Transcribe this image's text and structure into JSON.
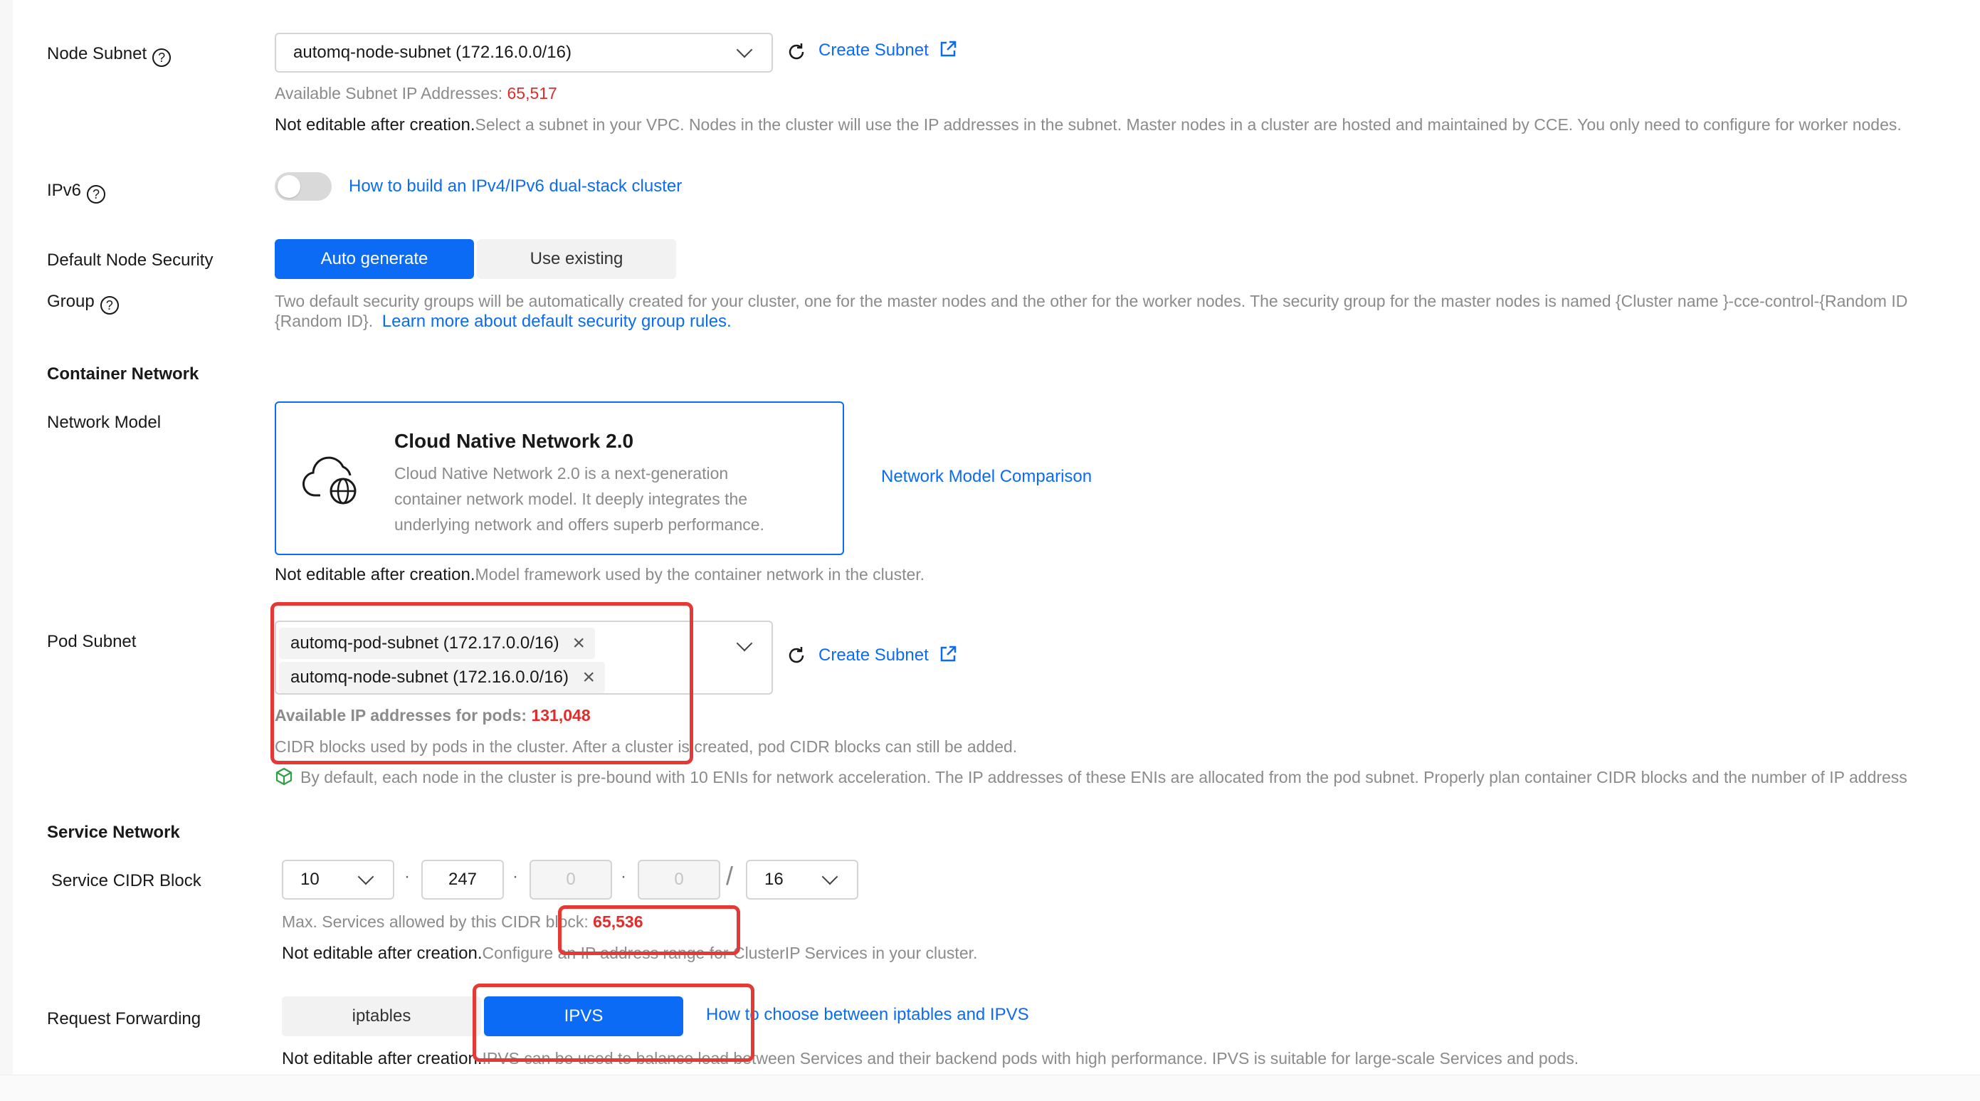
{
  "node_subnet": {
    "label": "Node Subnet",
    "help": "?",
    "selected": "automq-node-subnet (172.16.0.0/16)",
    "create_link": "Create Subnet",
    "available_label": "Available Subnet IP Addresses: ",
    "available_value": "65,517",
    "note_strong": "Not editable after creation.",
    "note_text": "Select a subnet in your VPC. Nodes in the cluster will use the IP addresses in the subnet. Master nodes in a cluster are hosted and maintained by CCE. You only need to configure for worker nodes."
  },
  "ipv6": {
    "label": "IPv6",
    "help": "?",
    "enabled": false,
    "link": "How to build an IPv4/IPv6 dual-stack cluster"
  },
  "security_group": {
    "label_line1": "Default Node Security",
    "label_line2": "Group",
    "help": "?",
    "option_active": "Auto generate",
    "option_inactive": "Use existing",
    "desc_line1": "Two default security groups will be automatically created for your cluster, one for the master nodes and the other for the worker nodes. The security group for the master nodes is named {Cluster name }-cce-control-{Random ID",
    "desc_line2": "{Random ID}.",
    "learn_more": "Learn more about default security group rules."
  },
  "container_network": {
    "title": "Container Network",
    "model_label": "Network Model",
    "card_title": "Cloud Native Network 2.0",
    "card_desc_1": "Cloud Native Network 2.0 is a next-generation",
    "card_desc_2": "container network model. It deeply integrates the",
    "card_desc_3": "underlying network and offers superb performance.",
    "comparison_link": "Network Model Comparison",
    "note_strong": "Not editable after creation.",
    "note_text": "Model framework used by the container network in the cluster."
  },
  "pod_subnet": {
    "label": "Pod Subnet",
    "tags": [
      "automq-pod-subnet (172.17.0.0/16)",
      "automq-node-subnet (172.16.0.0/16)"
    ],
    "create_link": "Create Subnet",
    "available_label": "Available IP addresses for pods: ",
    "available_value": "131,048",
    "desc": "CIDR blocks used by pods in the cluster. After a cluster is created, pod CIDR blocks can still be added.",
    "eni_note": "By default, each node in the cluster is pre-bound with 10 ENIs for network acceleration. The IP addresses of these ENIs are allocated from the pod subnet. Properly plan container CIDR blocks and the number of IP address"
  },
  "service_network": {
    "title": "Service Network",
    "cidr_label": "Service CIDR Block",
    "octet1": "10",
    "octet2": "247",
    "octet3": "0",
    "octet4": "0",
    "mask": "16",
    "max_label": "Max. Services allowed by this CIDR block: ",
    "max_value": "65,536",
    "note_strong": "Not editable after creation.",
    "note_text": "Configure an IP address range for ClusterIP Services in your cluster."
  },
  "request_forwarding": {
    "label": "Request Forwarding",
    "option_inactive": "iptables",
    "option_active": "IPVS",
    "link": "How to choose between iptables and IPVS",
    "note_strong": "Not editable after creation.",
    "note_text": "IPVS can be used to balance load between Services and their backend pods with high performance. IPVS is suitable for large-scale Services and pods."
  },
  "colors": {
    "accent": "#0b6bf4",
    "highlight_red": "#e22b2b",
    "annotation_box": "#e53935"
  }
}
